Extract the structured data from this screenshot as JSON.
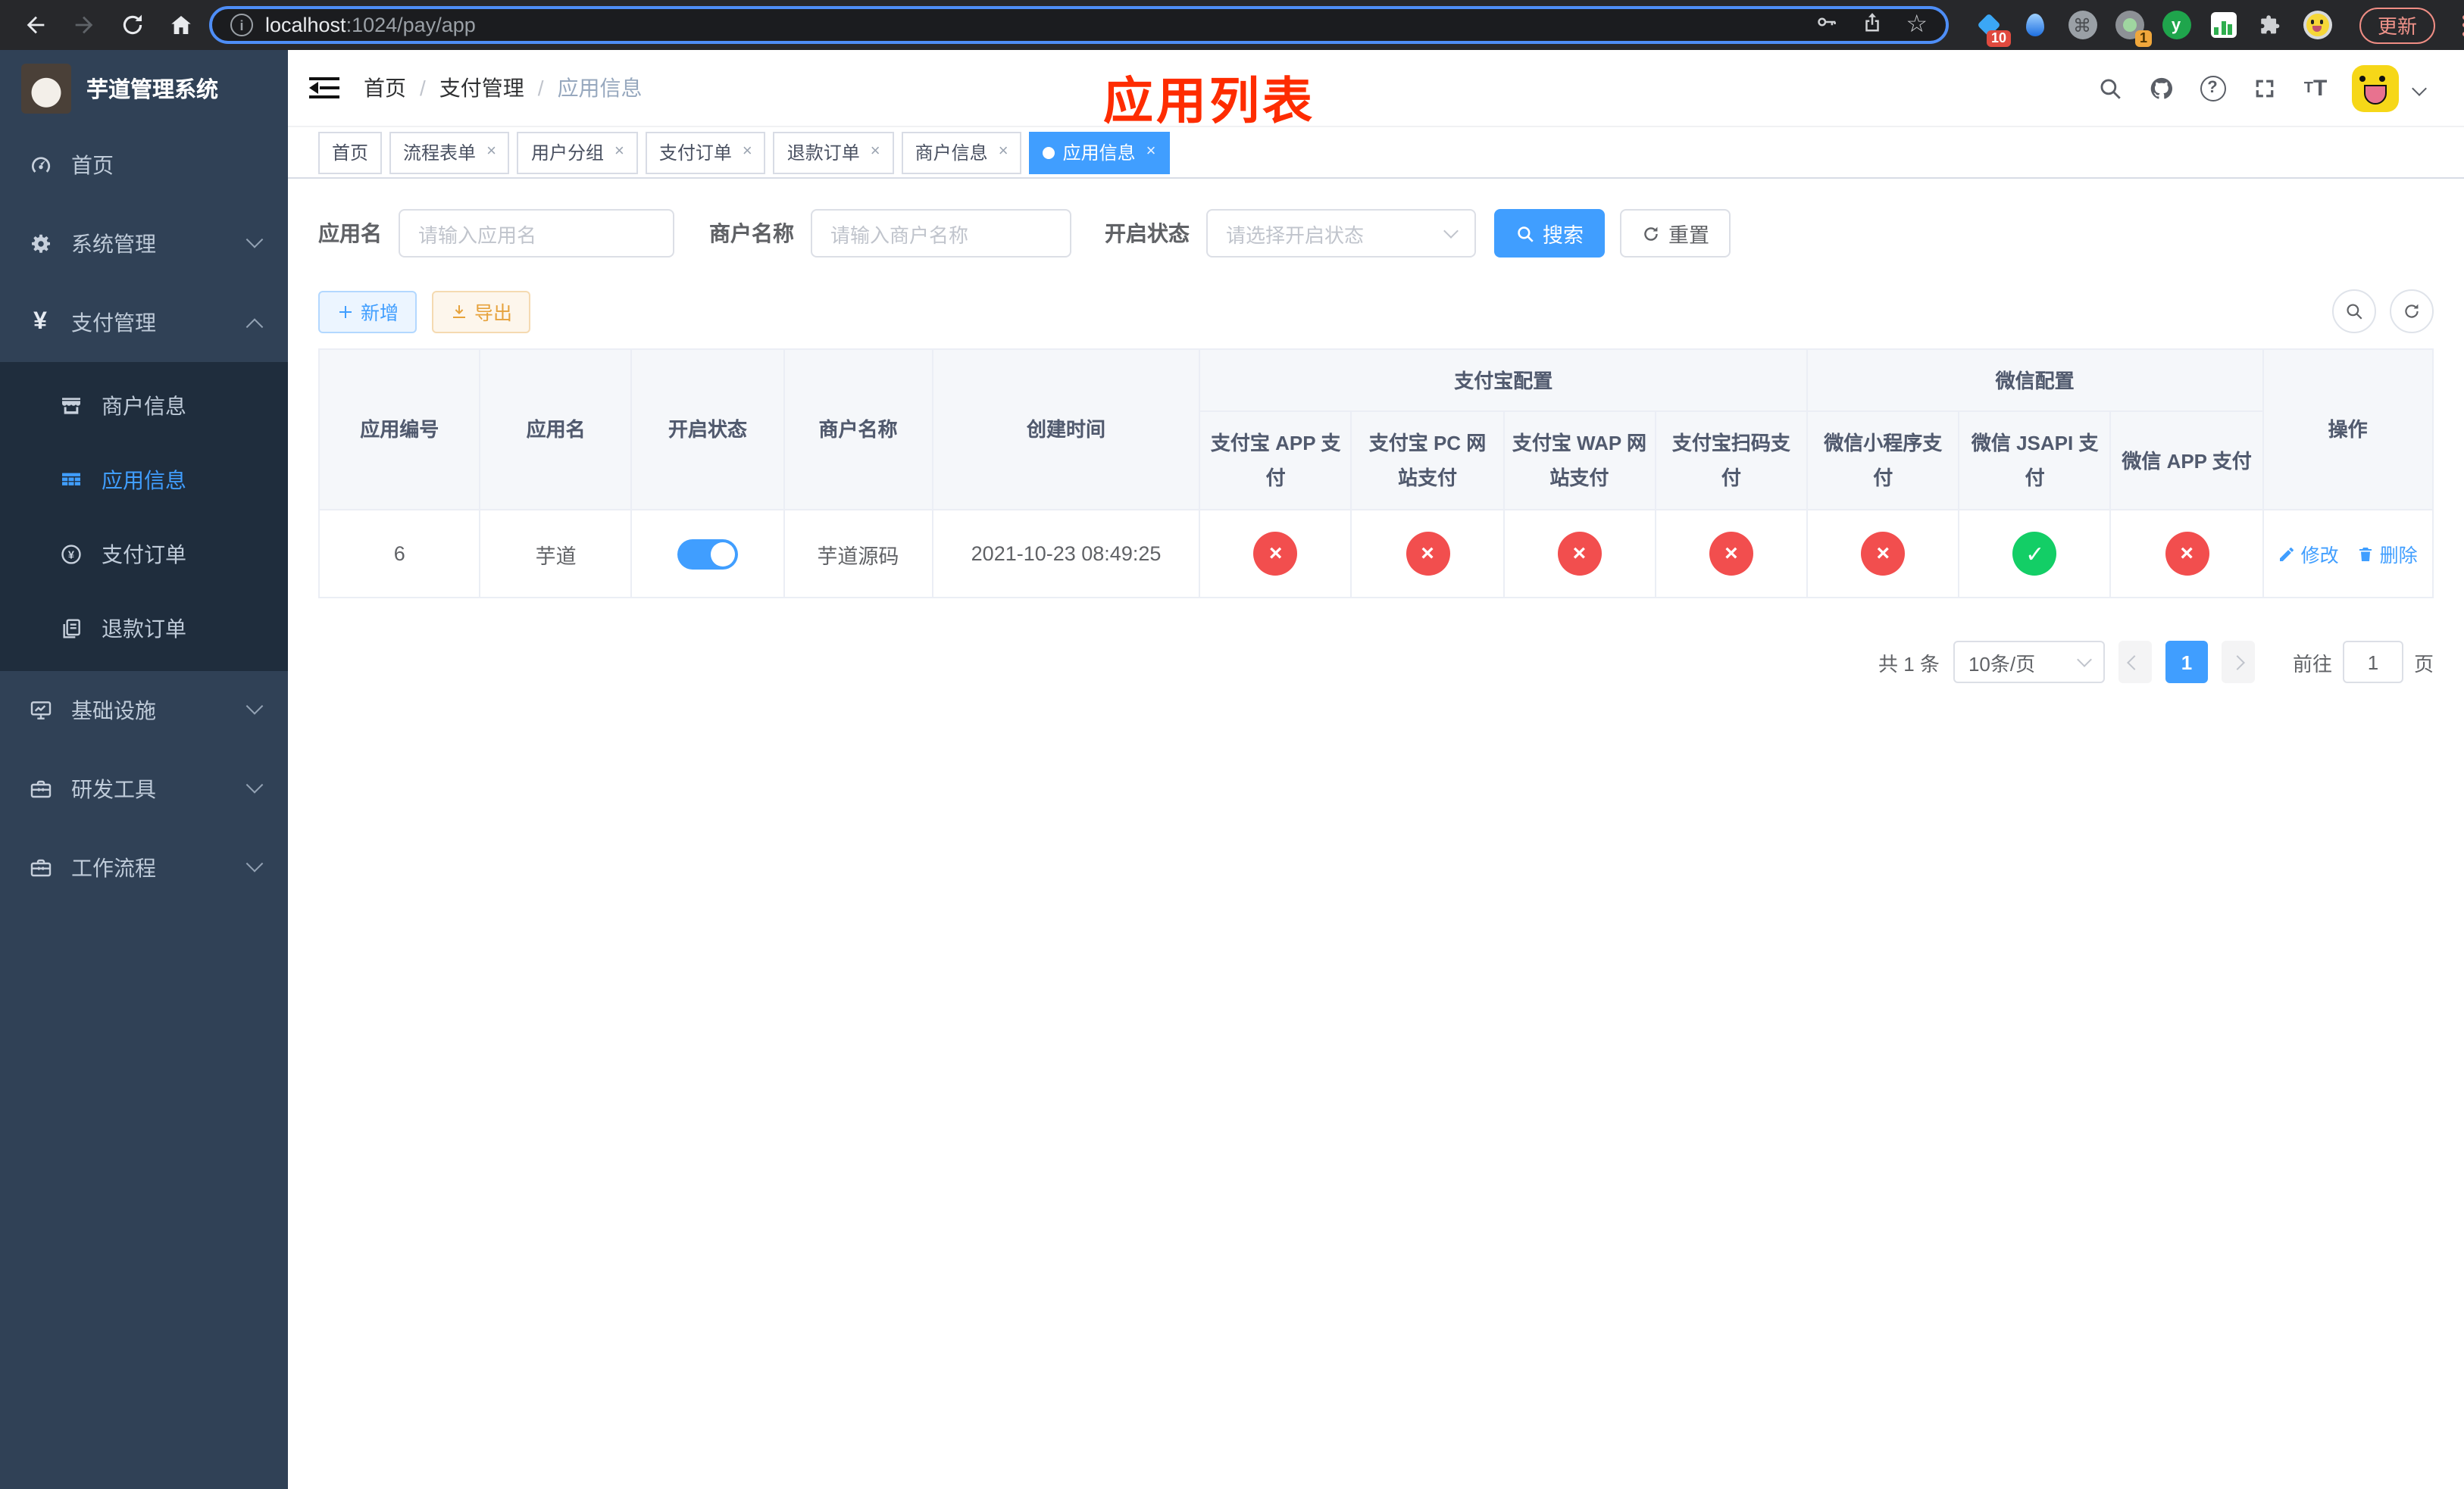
{
  "browser": {
    "url": {
      "host": "localhost",
      "rest": ":1024/pay/app"
    },
    "update_label": "更新",
    "extensions": {
      "badge_blue_diamond": "10",
      "badge_gray_circle": "1",
      "green_letter": "y"
    }
  },
  "annotation": "应用列表",
  "sidebar": {
    "title": "芋道管理系统",
    "items": [
      {
        "label": "首页"
      },
      {
        "label": "系统管理"
      },
      {
        "label": "支付管理"
      },
      {
        "label": "商户信息"
      },
      {
        "label": "应用信息"
      },
      {
        "label": "支付订单"
      },
      {
        "label": "退款订单"
      },
      {
        "label": "基础设施"
      },
      {
        "label": "研发工具"
      },
      {
        "label": "工作流程"
      }
    ]
  },
  "navbar": {
    "breadcrumb": [
      "首页",
      "支付管理",
      "应用信息"
    ]
  },
  "tabs": [
    {
      "label": "首页",
      "closable": false,
      "active": false
    },
    {
      "label": "流程表单",
      "closable": true,
      "active": false
    },
    {
      "label": "用户分组",
      "closable": true,
      "active": false
    },
    {
      "label": "支付订单",
      "closable": true,
      "active": false
    },
    {
      "label": "退款订单",
      "closable": true,
      "active": false
    },
    {
      "label": "商户信息",
      "closable": true,
      "active": false
    },
    {
      "label": "应用信息",
      "closable": true,
      "active": true
    }
  ],
  "filters": {
    "app_name": {
      "label": "应用名",
      "placeholder": "请输入应用名"
    },
    "merchant_name": {
      "label": "商户名称",
      "placeholder": "请输入商户名称"
    },
    "status": {
      "label": "开启状态",
      "placeholder": "请选择开启状态"
    },
    "search_label": "搜索",
    "reset_label": "重置"
  },
  "toolbar": {
    "add_label": "新增",
    "export_label": "导出"
  },
  "table": {
    "simple_headers": [
      "应用编号",
      "应用名",
      "开启状态",
      "商户名称",
      "创建时间"
    ],
    "group_alipay": "支付宝配置",
    "group_wechat": "微信配置",
    "alipay_children": [
      "支付宝 APP 支付",
      "支付宝 PC 网站支付",
      "支付宝 WAP 网站支付",
      "支付宝扫码支付"
    ],
    "wechat_children": [
      "微信小程序支付",
      "微信 JSAPI 支付",
      "微信 APP 支付"
    ],
    "ops_header": "操作",
    "status_glyphs": {
      "yes": "✓",
      "no": "×"
    },
    "row": {
      "id": "6",
      "name": "芋道",
      "enabled": true,
      "merchant": "芋道源码",
      "created": "2021-10-23 08:49:25",
      "statuses": [
        "no",
        "no",
        "no",
        "no",
        "no",
        "yes",
        "no"
      ],
      "edit_label": "修改",
      "delete_label": "删除"
    }
  },
  "pagination": {
    "total": "共 1 条",
    "page_size": "10条/页",
    "current_page": "1",
    "goto_prefix": "前往",
    "goto_value": "1",
    "goto_suffix": "页"
  },
  "colors": {
    "accent": "#409eff",
    "status_yes": "#13ce66",
    "status_no": "#f24e4e",
    "annotation": "#fe2c00"
  }
}
